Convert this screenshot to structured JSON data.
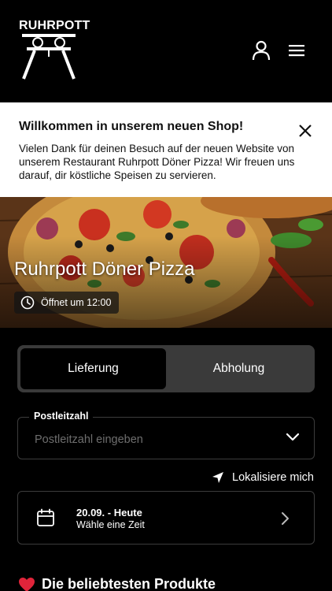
{
  "header": {
    "logo_text": "RUHRPOTT",
    "icons": {
      "user": "user-icon",
      "menu": "hamburger-menu-icon"
    }
  },
  "banner": {
    "title": "Willkommen in unserem neuen Shop!",
    "text": "Vielen Dank für deinen Besuch auf der neuen Website von unserem Restaurant Ruhrpott Döner Pizza! Wir freuen uns darauf, dir köstliche Speisen zu servieren.",
    "close_icon": "close-icon"
  },
  "hero": {
    "restaurant_name": "Ruhrpott Döner Pizza",
    "opening_status": "Öffnet um 12:00",
    "status_icon": "clock-icon"
  },
  "order_mode": {
    "options": [
      "Lieferung",
      "Abholung"
    ],
    "selected": "Lieferung"
  },
  "postcode": {
    "label": "Postleitzahl",
    "placeholder": "Postleitzahl eingeben"
  },
  "localize": {
    "label": "Lokalisiere mich",
    "icon": "location-arrow-icon"
  },
  "time_picker": {
    "date": "20.09. - Heute",
    "subtitle": "Wähle eine Zeit",
    "icon": "calendar-icon"
  },
  "popular": {
    "emoji": "❤️",
    "title": "Die beliebtesten Produkte"
  },
  "colors": {
    "background": "#000000",
    "banner_bg": "#ffffff",
    "toggle_bg": "#3a3a3a",
    "border": "#3c3c3c",
    "heart": "#e0243a"
  }
}
